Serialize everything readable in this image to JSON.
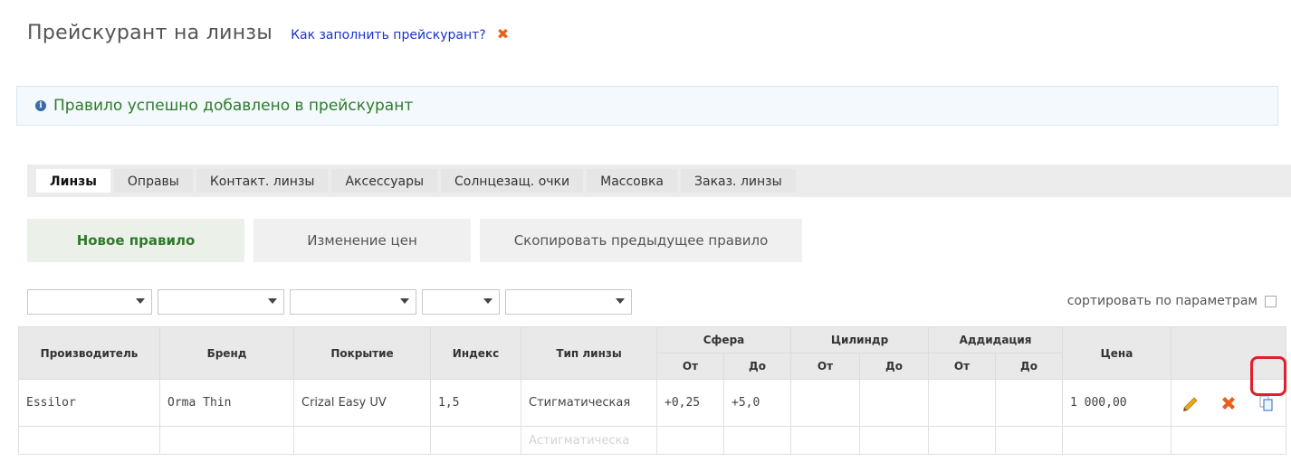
{
  "header": {
    "title": "Прейскурант на линзы",
    "help_link": "Как заполнить прейскурант?"
  },
  "notice": {
    "text": "Правило успешно добавлено в прейскурант"
  },
  "tabs": [
    {
      "label": "Линзы",
      "active": true
    },
    {
      "label": "Оправы"
    },
    {
      "label": "Контакт. линзы"
    },
    {
      "label": "Аксессуары"
    },
    {
      "label": "Солнцезащ. очки"
    },
    {
      "label": "Массовка"
    },
    {
      "label": "Заказ. линзы"
    }
  ],
  "actions": {
    "new_rule": "Новое правило",
    "change_prices": "Изменение цен",
    "copy_prev_rule": "Скопировать предыдущее правило"
  },
  "filters": {
    "sort_label": "сортировать по параметрам"
  },
  "table": {
    "headers": {
      "manufacturer": "Производитель",
      "brand": "Бренд",
      "coating": "Покрытие",
      "index": "Индекс",
      "lens_type": "Тип линзы",
      "sphere": "Сфера",
      "cylinder": "Цилиндр",
      "addition": "Аддидация",
      "price": "Цена",
      "from": "От",
      "to": "До"
    },
    "rows": [
      {
        "manufacturer": "Essilor",
        "brand": "Orma Thin",
        "coating": "Crizal Easy UV",
        "index": "1,5",
        "lens_type": "Стигматическая",
        "sphere_from": "+0,25",
        "sphere_to": "+5,0",
        "cyl_from": "",
        "cyl_to": "",
        "add_from": "",
        "add_to": "",
        "price": "1 000,00"
      },
      {
        "lens_type": "Астигматическа"
      }
    ]
  },
  "icons": {
    "edit": "pencil-icon",
    "delete": "delete-icon",
    "copy": "copy-icon",
    "colors": {
      "edit": "#e7a81c",
      "delete": "#e8611a",
      "copy": "#2e6bbf",
      "highlight": "#e21f2a"
    }
  }
}
